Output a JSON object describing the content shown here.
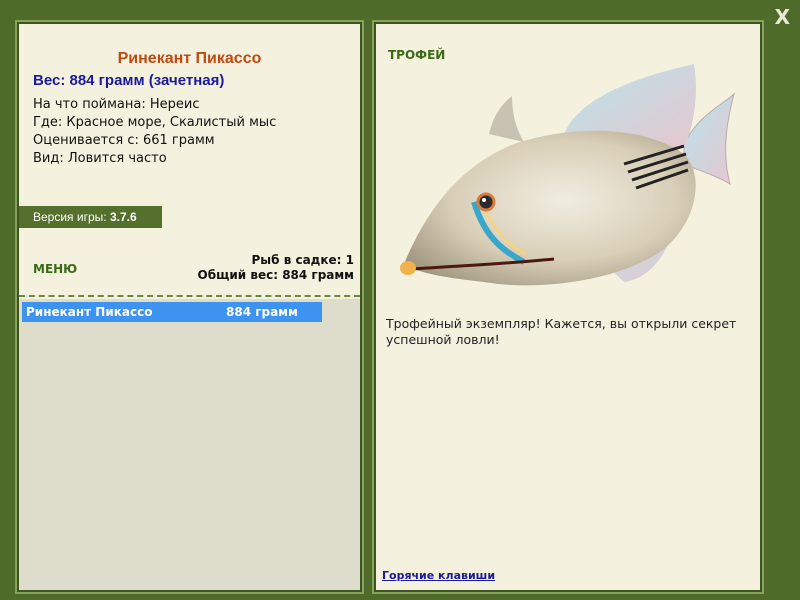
{
  "window": {
    "close_label": "X"
  },
  "catch": {
    "fish_name": "Ринекант Пикассо",
    "weight_line": "Вес: 884 грамм (зачетная)",
    "caught_on": "На что поймана: Нереис",
    "location": "Где: Красное море, Скалистый мыс",
    "rated_from": "Оценивается с: 661 грамм",
    "frequency": "Вид: Ловится часто"
  },
  "version": {
    "label": "Версия игры:",
    "value": "3.7.6"
  },
  "menu": {
    "label": "МЕНЮ"
  },
  "keepnet": {
    "count_line": "Рыб в садке: 1",
    "total_line": "Общий вес: 884 грамм",
    "items": [
      {
        "name": "Ринекант Пикассо",
        "weight": "884 грамм"
      }
    ]
  },
  "trophy": {
    "title": "ТРОФЕЙ",
    "description": "Трофейный экземпляр! Кажется, вы открыли секрет успешной ловли!",
    "hotkeys_label": "Горячие клавиши"
  }
}
